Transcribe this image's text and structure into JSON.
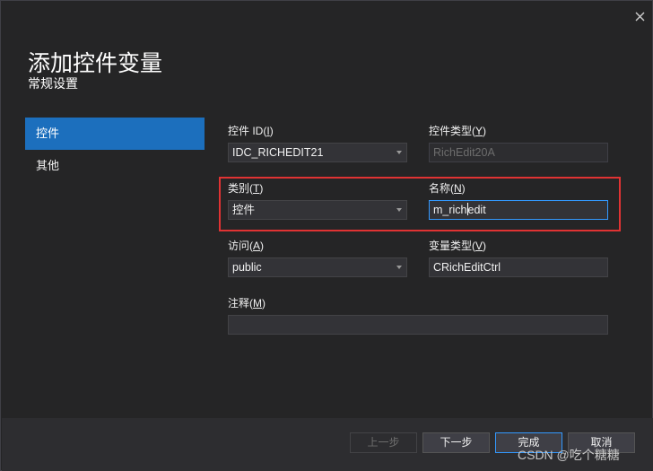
{
  "dialog": {
    "title": "添加控件变量",
    "subtitle": "常规设置"
  },
  "sidebar": {
    "items": [
      {
        "label": "控件",
        "active": true
      },
      {
        "label": "其他",
        "active": false
      }
    ]
  },
  "form": {
    "control_id": {
      "label": "控件 ID(",
      "hotkey": "I",
      "label_end": ")",
      "value": "IDC_RICHEDIT21"
    },
    "control_type": {
      "label": "控件类型(",
      "hotkey": "Y",
      "label_end": ")",
      "value": "RichEdit20A"
    },
    "category": {
      "label": "类别(",
      "hotkey": "T",
      "label_end": ")",
      "value": "控件"
    },
    "name": {
      "label": "名称(",
      "hotkey": "N",
      "label_end": ")",
      "value_before_caret": "m_rich",
      "value_after_caret": "edit"
    },
    "access": {
      "label": "访问(",
      "hotkey": "A",
      "label_end": ")",
      "value": "public"
    },
    "variable_type": {
      "label": "变量类型(",
      "hotkey": "V",
      "label_end": ")",
      "value": "CRichEditCtrl"
    },
    "comment": {
      "label": "注释(",
      "hotkey": "M",
      "label_end": ")",
      "value": ""
    }
  },
  "buttons": {
    "prev": "上一步",
    "next": "下一步",
    "finish": "完成",
    "cancel": "取消"
  },
  "watermark": "CSDN @吃个糖糖",
  "colors": {
    "accent": "#1c6fbd",
    "highlight_box": "#e03333",
    "focus_border": "#3399ff"
  },
  "icons": [
    "close-icon",
    "dropdown-arrow-icon"
  ]
}
